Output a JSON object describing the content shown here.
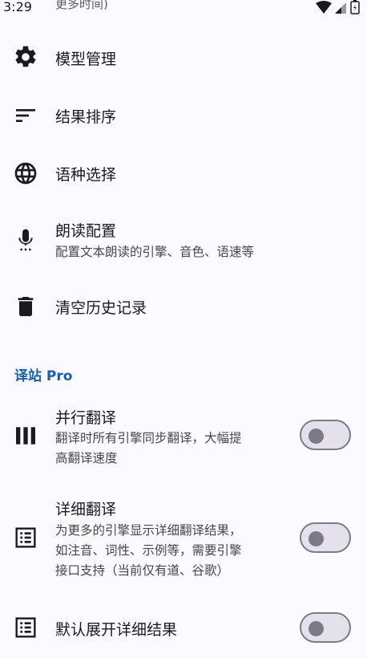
{
  "status_bar": {
    "time": "3:29",
    "clipped_text": "更多时间)"
  },
  "settings": {
    "model_manage": {
      "label": "模型管理",
      "icon": "gear-icon"
    },
    "result_sort": {
      "label": "结果排序",
      "icon": "sort-icon"
    },
    "language_select": {
      "label": "语种选择",
      "icon": "globe-icon"
    },
    "read_aloud": {
      "label": "朗读配置",
      "subtitle": "配置文本朗读的引擎、音色、语速等",
      "icon": "microphone-icon"
    },
    "clear_history": {
      "label": "清空历史记录",
      "icon": "trash-icon"
    }
  },
  "pro_section": {
    "header": "译站 Pro",
    "parallel": {
      "label": "并行翻译",
      "subtitle_line1": "翻译时所有引擎同步翻译，大幅提",
      "subtitle_line2": "高翻译速度",
      "icon": "columns-icon",
      "enabled": false
    },
    "detailed": {
      "label": "详细翻译",
      "subtitle_line1": "为更多的引擎显示详细翻译结果，",
      "subtitle_line2": "如注音、词性、示例等，需要引擎",
      "subtitle_line3": "接口支持（当前仅有道、谷歌）",
      "icon": "list-box-icon",
      "enabled": false
    },
    "expand_default": {
      "label": "默认展开详细结果",
      "icon": "list-box-icon",
      "enabled": false
    }
  },
  "colors": {
    "accent": "#1a5fa8",
    "background": "#fbfafe",
    "toggle_off_track": "#e4e1ec",
    "toggle_off_outline": "#7c7b84"
  }
}
